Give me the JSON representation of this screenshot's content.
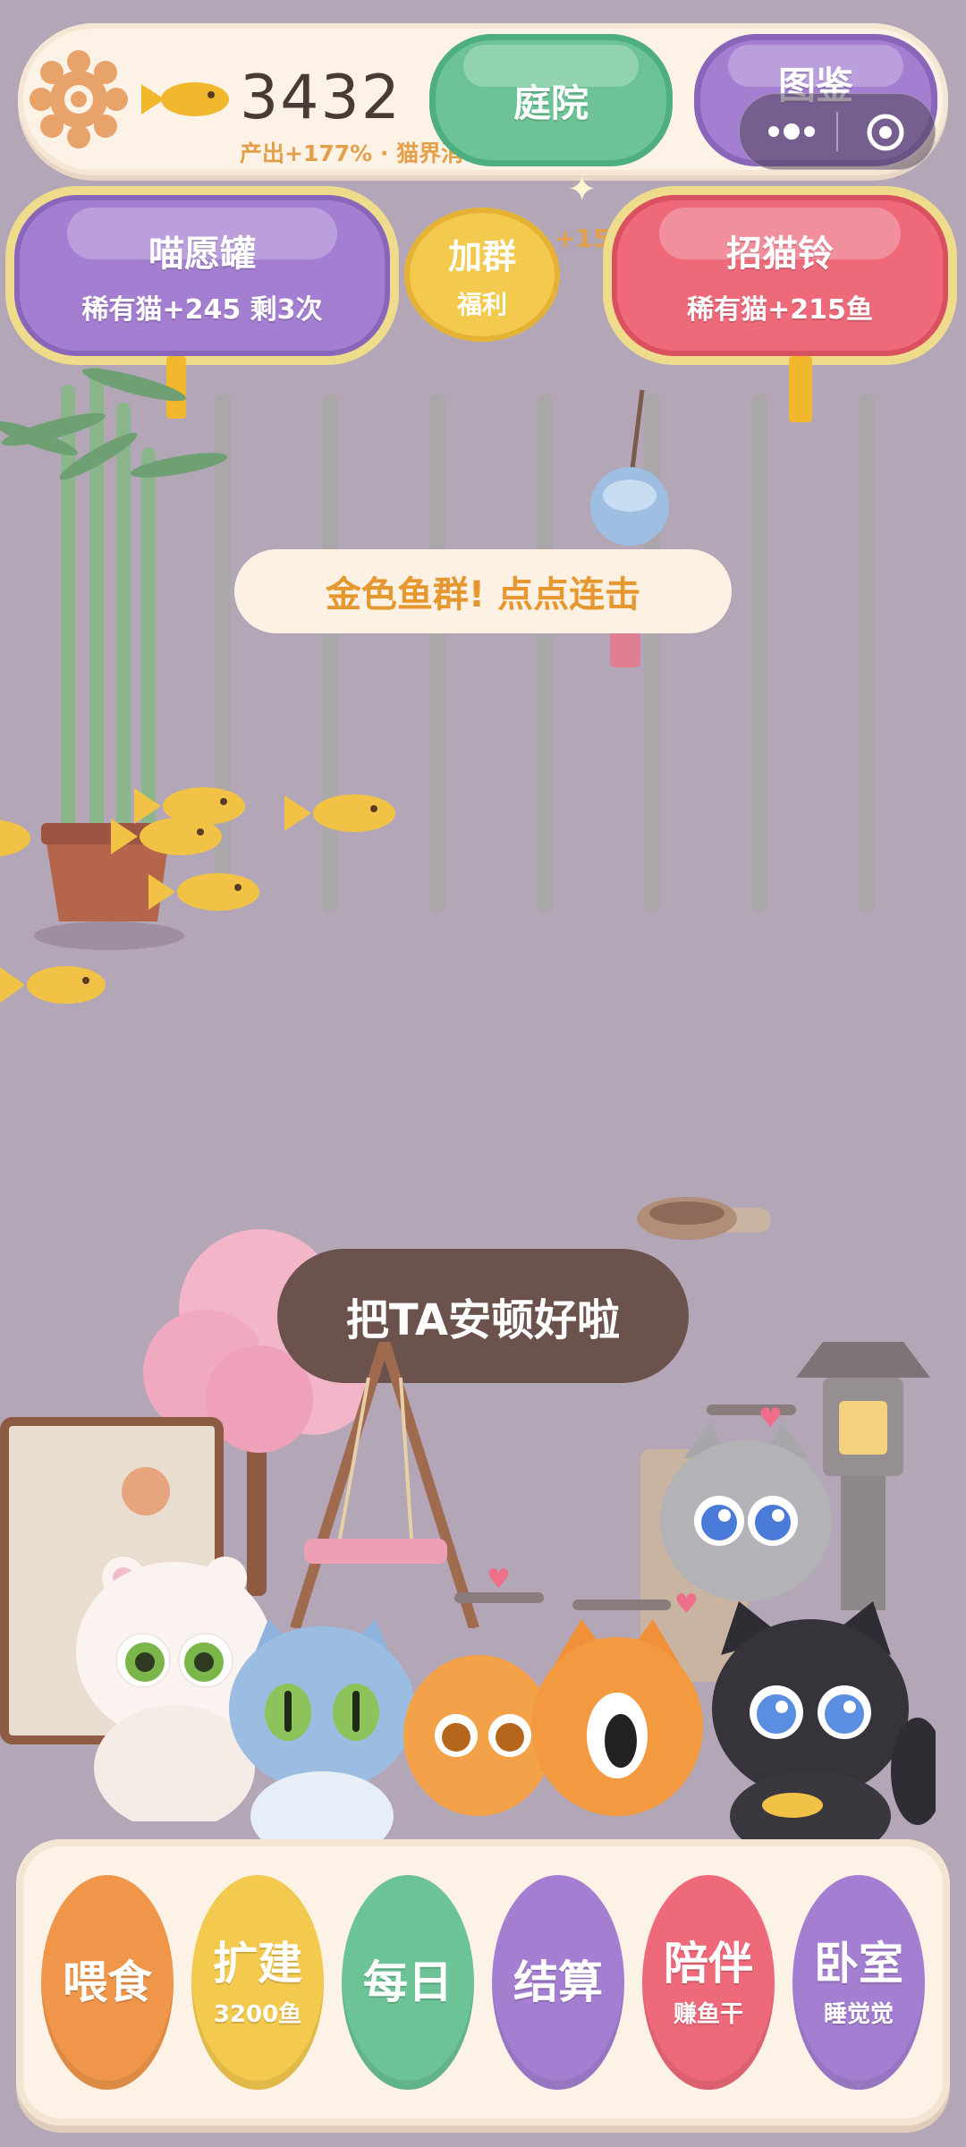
{
  "top_bar": {
    "fish_count": "3432",
    "production_text": "产出+177% · 猫界消...",
    "courtyard_label": "庭院",
    "catalog_label": "图鉴"
  },
  "mini_menu": {
    "more_icon": "more-dots-icon",
    "close_icon": "target-close-icon"
  },
  "second_row": {
    "wish_jar": {
      "title": "喵愿罐",
      "subtitle": "稀有猫+245 剩3次"
    },
    "group": {
      "title": "加群",
      "subtitle": "福利"
    },
    "bonus_text": "+150",
    "cat_bell": {
      "title": "招猫铃",
      "subtitle": "稀有猫+215鱼"
    }
  },
  "golden_fish_banner": "金色鱼群! 点点连击",
  "settle_toast": "把TA安顿好啦",
  "bottom_menu": {
    "items": [
      {
        "label": "喂食",
        "sub": "",
        "color": "#f0964a"
      },
      {
        "label": "扩建",
        "sub": "3200鱼",
        "color": "#f3c94e"
      },
      {
        "label": "每日",
        "sub": "",
        "color": "#6cc395"
      },
      {
        "label": "结算",
        "sub": "",
        "color": "#a47fd1"
      },
      {
        "label": "陪伴",
        "sub": "赚鱼干",
        "color": "#ee6a7b"
      },
      {
        "label": "卧室",
        "sub": "睡觉觉",
        "color": "#a47fd1"
      }
    ]
  },
  "colors": {
    "background": "#b3a6b7",
    "top_bar": "#fdf2e6",
    "courtyard_green": "#6cc395",
    "catalog_purple": "#a47fd1",
    "bell_red": "#ee6a7b",
    "group_yellow": "#f3c94e"
  }
}
